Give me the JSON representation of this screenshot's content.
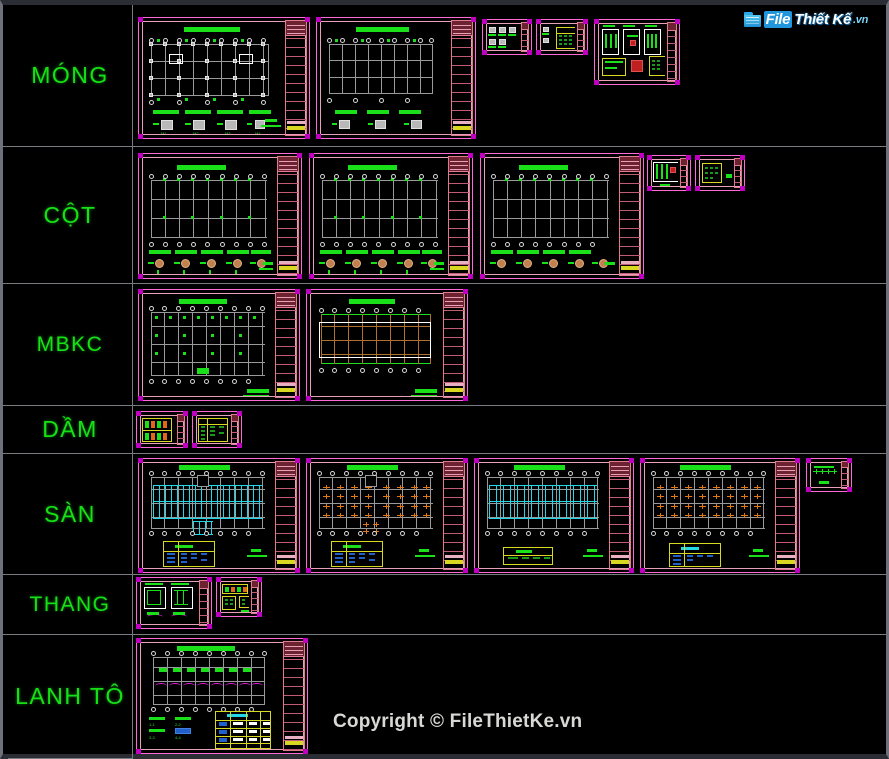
{
  "window": {
    "background_color": "#000000",
    "frame_color": "#6e7179"
  },
  "watermark": {
    "logo_word_1": "File",
    "logo_word_2": "Thiết Kế",
    "logo_word_3": ".vn",
    "logo_icon": "folder-icon",
    "accent_color": "#2196dd"
  },
  "copyright": {
    "text": "Copyright © FileThietKe.vn",
    "color": "#d8d8d4"
  },
  "grid": {
    "label_color": "#16e016",
    "divider_color": "#787b80",
    "rows": [
      {
        "id": "mong",
        "label": "MÓNG",
        "sheet_count": 5,
        "description": "Foundation plan and footing details"
      },
      {
        "id": "cot",
        "label": "CỘT",
        "sheet_count": 5,
        "description": "Column layout plans and column sections"
      },
      {
        "id": "mbkc",
        "label": "MBKC",
        "sheet_count": 2,
        "description": "Structural framing plans"
      },
      {
        "id": "dam",
        "label": "DẦM",
        "sheet_count": 2,
        "description": "Beam schedules and details"
      },
      {
        "id": "san",
        "label": "SÀN",
        "sheet_count": 5,
        "description": "Floor slab reinforcement plans"
      },
      {
        "id": "thang",
        "label": "THANG",
        "sheet_count": 2,
        "description": "Staircase sections and rebar schedule"
      },
      {
        "id": "lanh_to",
        "label": "LANH TÔ",
        "sheet_count": 1,
        "description": "Lintel plan with schedule table"
      }
    ]
  },
  "cad_colors": {
    "sheet_border": "#ff6ad5",
    "sheet_corner": "#c000c0",
    "inner_frame": "#e8a0b8",
    "titleblock": "#e07a90",
    "green_line": "#1ae01a",
    "grid_line": "#9a9a9a",
    "rebar_cyan": "#22d8e8",
    "rebar_orange": "#e07818",
    "table_yellow": "#d8d820",
    "table_blue": "#2060c8"
  }
}
